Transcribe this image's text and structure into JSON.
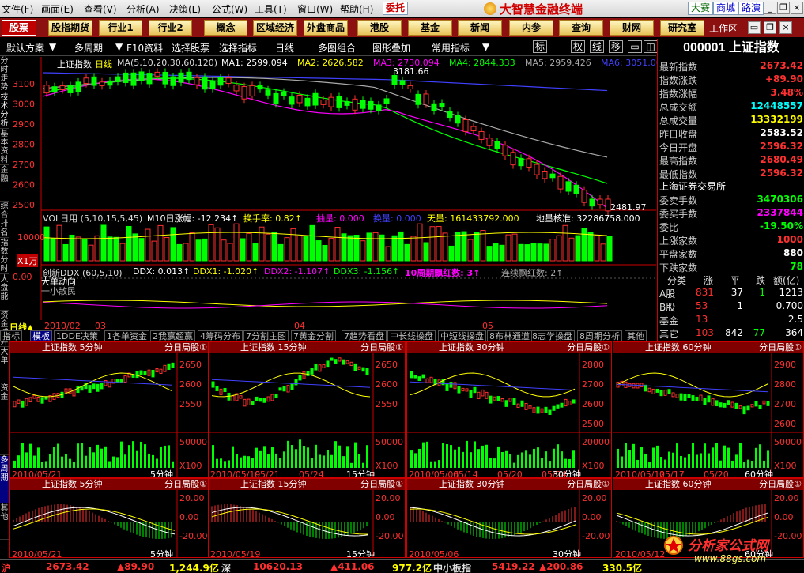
{
  "menu": [
    "文件(F)",
    "画面(E)",
    "查看(V)",
    "分析(A)",
    "决策(L)",
    "公式(W)",
    "工具(T)",
    "窗口(W)",
    "帮助(H)"
  ],
  "top_buttons": [
    "委托",
    "大赛",
    "商城",
    "路演"
  ],
  "app_title": "大智慧金融终端",
  "toolbar": [
    "股票",
    "股指期货",
    "行业1",
    "行业2",
    "概念",
    "区域经济",
    "外盘商品",
    "港股",
    "基金",
    "新闻",
    "内参",
    "查询",
    "财网",
    "研究室"
  ],
  "workspace_label": "工作区",
  "toolbar2": [
    "默认方案",
    "多周期",
    "F10资料",
    "选择股票",
    "选择指标",
    "日线",
    "多图组合",
    "图形叠加",
    "常用指标"
  ],
  "toolbar2_small": [
    "标",
    "权",
    "线",
    "移"
  ],
  "left_tabs": [
    "分时走势",
    "技术分析",
    "基本资料",
    "金融",
    "综合排名",
    "指数分时",
    "大盘能",
    "资金博弈",
    "大单",
    "资金",
    "多周期",
    "其他"
  ],
  "main": {
    "stock_name": "上证指数",
    "period": "日线",
    "ma_header": "MA(5,10,20,30,60,120)",
    "ma_values": [
      "MA1: 2599.094",
      "MA2: 2626.582",
      "MA3: 2730.094",
      "MA4: 2844.333",
      "MA5: 2959.426",
      "MA6: 3051.00"
    ],
    "ma_colors": [
      "#ffffff",
      "#ffff00",
      "#ff00ff",
      "#00ff00",
      "#aaaaaa",
      "#4040ff"
    ],
    "price_high_label": "3181.66",
    "price_low_label": "2481.97",
    "y_ticks": [
      "3100",
      "3000",
      "2900",
      "2800",
      "2700",
      "2600",
      "2500"
    ],
    "vol_header": "VOL日用 (5,10,15,5,45)",
    "vol_text": [
      "M10日涨幅: -12.234↑",
      "换手率: 0.82↑",
      "抽量: 0.000",
      "换量: 0.000",
      "天量: 161433792.000",
      "地量核准: 32286758.000"
    ],
    "vol_ticks": [
      "10000",
      "X1万"
    ],
    "ddx_header": "创新DDX (60,5,10)",
    "ddx_values": [
      "DDX: 0.013↑",
      "DDX1: -1.020↑",
      "DDX2: -1.107↑",
      "DDX3: -1.156↑",
      "10周期飘红数: 3↑",
      "连续飘红数: 2↑"
    ],
    "ddx_sub1": "大单动向",
    "ddx_sub2": "一小散民",
    "ddx_tick": "0.00",
    "date_labels": [
      "2010/02",
      "03",
      "04",
      "05"
    ]
  },
  "right": {
    "code_title": "000001 上证指数",
    "rows": [
      {
        "label": "最新指数",
        "value": "2673.42",
        "color": "#ff3030"
      },
      {
        "label": "指数涨跌",
        "value": "+89.90",
        "color": "#ff3030"
      },
      {
        "label": "指数涨幅",
        "value": "3.48%",
        "color": "#ff3030"
      },
      {
        "label": "总成交额",
        "value": "12448557",
        "color": "#00ffff"
      },
      {
        "label": "总成交量",
        "value": "13332199",
        "color": "#ffff00"
      },
      {
        "label": "昨日收盘",
        "value": "2583.52",
        "color": "#ffffff"
      },
      {
        "label": "今日开盘",
        "value": "2596.32",
        "color": "#ff3030"
      },
      {
        "label": "最高指数",
        "value": "2680.49",
        "color": "#ff3030"
      },
      {
        "label": "最低指数",
        "value": "2596.32",
        "color": "#ff3030"
      }
    ],
    "exchange": "上海证券交易所",
    "rows2": [
      {
        "label": "委卖手数",
        "value": "3470306",
        "color": "#00ff00"
      },
      {
        "label": "委买手数",
        "value": "2337844",
        "color": "#ff00ff"
      },
      {
        "label": "委比",
        "value": "-19.50%",
        "color": "#00ff00"
      },
      {
        "label": "上涨家数",
        "value": "1000",
        "color": "#ff3030"
      },
      {
        "label": "平盘家数",
        "value": "880",
        "color": "#ffffff"
      },
      {
        "label": "下跌家数",
        "value": "78",
        "color": "#00ff00"
      }
    ],
    "cat_headers": [
      "分类",
      "涨",
      "平",
      "跌",
      "额(亿)"
    ],
    "cat_rows": [
      {
        "name": "A股",
        "up": "831",
        "flat": "37",
        "down": "1",
        "amt": "1213"
      },
      {
        "name": "B股",
        "up": "53",
        "flat": "1",
        "down": "",
        "amt": "0.700"
      },
      {
        "name": "基金",
        "up": "13",
        "flat": "",
        "down": "",
        "amt": "2.5"
      },
      {
        "name": "其它",
        "up": "103",
        "flat": "842",
        "down": "77",
        "amt": "364"
      }
    ]
  },
  "tabs": [
    "指标",
    "模板",
    "1DDE决策",
    "1各单资金",
    "2我赢超赢",
    "4筹码分布",
    "7分割主图",
    "7黄金分割",
    "7趋势看盘",
    "中长线操盘",
    "中短线操盘",
    "8布林通道",
    "8志学操盘",
    "8周期分析",
    "其他"
  ],
  "mini_titles": [
    "上证指数 5分钟",
    "上证指数 15分钟",
    "上证指数 30分钟",
    "上证指数 60分钟"
  ],
  "mini_btns": "分日局股①",
  "mini_yticks": [
    [
      "2650",
      "2600",
      "2550"
    ],
    [
      "2650",
      "2600",
      "2550"
    ],
    [
      "2800",
      "2700",
      "2600",
      "2500"
    ],
    [
      "2900",
      "2800",
      "2700",
      "2600"
    ]
  ],
  "mini_vol_ticks": [
    [
      "50000",
      "X100"
    ],
    [
      "50000",
      "X100"
    ],
    [
      "20000",
      "X100"
    ],
    [
      "50000",
      "X100"
    ]
  ],
  "mini_dates": [
    [
      "2010/05/21",
      ""
    ],
    [
      "2010/05/19",
      "05/21",
      "05/24"
    ],
    [
      "2010/05/06",
      "05/14",
      "05/20",
      "05/24"
    ],
    [
      "2010/05/12",
      "05/17",
      "05/20"
    ]
  ],
  "mini_period": [
    "5分钟",
    "15分钟",
    "30分钟",
    "60分钟"
  ],
  "macd_ticks": [
    [
      "20.00",
      "0.00",
      "-20.00"
    ],
    [
      "20.00",
      "0.00",
      "-20.00"
    ],
    [
      "20.00",
      "0.00",
      "-20.00"
    ],
    [
      "20.00",
      "0.00",
      "-20.00"
    ]
  ],
  "macd_dates": [
    "2010/05/21",
    "2010/05/19",
    "2010/05/06",
    "2010/05/12"
  ],
  "status": {
    "sh_label": "沪",
    "sh_price": "2673.42",
    "sh_change": "▲89.90",
    "sh_amt": "1,244.9亿",
    "sz_label": "深",
    "sz_price": "10620.13",
    "sz_change": "▲411.06",
    "sz_amt": "977.2亿",
    "zx_label": "中小板指",
    "zx_price": "5419.22",
    "zx_change": "▲200.86",
    "zx_amt": "330.5亿"
  },
  "watermark": {
    "line1": "分析家公式网",
    "line2": "www.88gs.com"
  }
}
